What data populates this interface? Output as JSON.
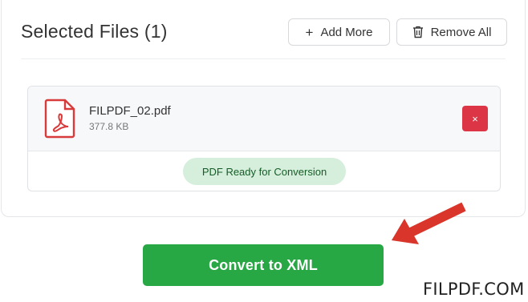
{
  "header": {
    "title": "Selected Files (1)",
    "add_more_label": "Add More",
    "remove_all_label": "Remove All"
  },
  "files": [
    {
      "name": "FILPDF_02.pdf",
      "size": "377.8 KB",
      "remove_symbol": "×",
      "status": "PDF Ready for Conversion"
    }
  ],
  "actions": {
    "convert_label": "Convert to XML"
  },
  "watermark": "FILPDF.COM",
  "icons": [
    "plus-icon",
    "trash-icon",
    "pdf-file-icon",
    "close-icon",
    "red-arrow-icon"
  ],
  "colors": {
    "accent_green": "#28a745",
    "danger_red": "#dc3545",
    "badge_bg": "#d6eedc",
    "badge_text": "#155d27",
    "pdf_red": "#d83b3b",
    "arrow_red": "#d9352a"
  }
}
